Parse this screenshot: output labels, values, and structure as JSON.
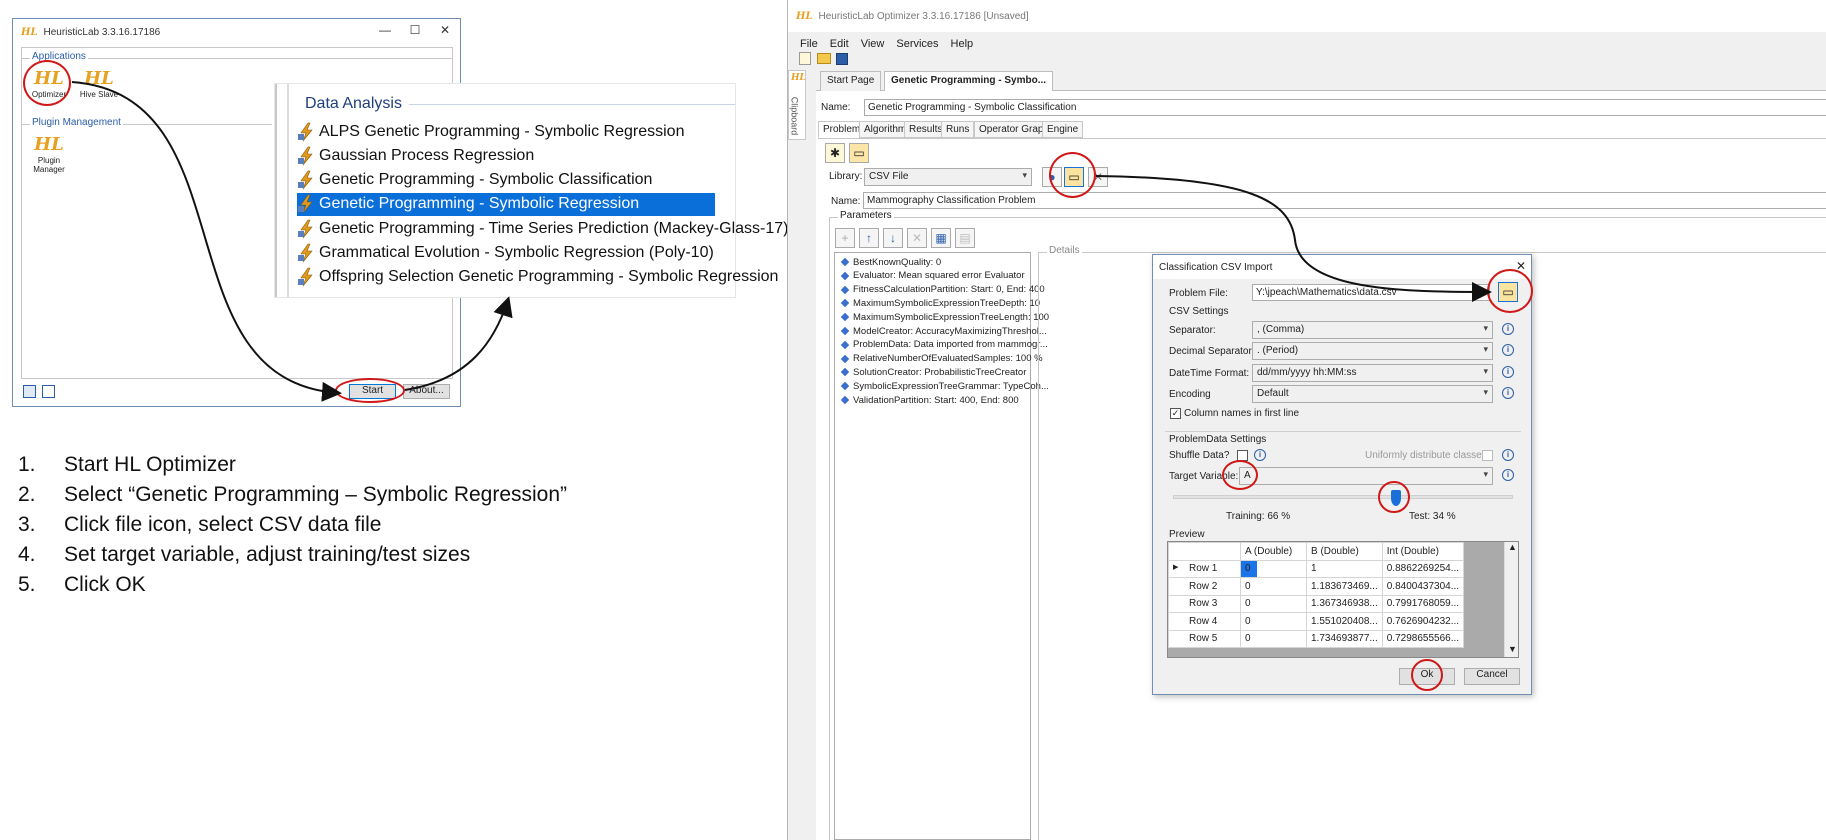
{
  "launcher": {
    "title": "HeuristicLab 3.3.16.17186",
    "title_logo": "HL",
    "minimize": "—",
    "maximize": "☐",
    "close": "✕",
    "applications_group": "Applications",
    "plugin_group": "Plugin Management",
    "apps": [
      {
        "logo": "HL",
        "label": "Optimizer"
      },
      {
        "logo": "HL",
        "label": "Hive Slave"
      }
    ],
    "plugin_app": {
      "logo": "HL",
      "label": "Plugin Manager"
    },
    "start_button": "Start",
    "about_button": "About..."
  },
  "data_analysis": {
    "heading": "Data Analysis",
    "items": [
      "ALPS Genetic Programming - Symbolic Regression",
      "Gaussian Process Regression",
      "Genetic Programming - Symbolic Classification",
      "Genetic Programming - Symbolic Regression",
      "Genetic Programming - Time Series Prediction (Mackey-Glass-17)",
      "Grammatical Evolution - Symbolic Regression (Poly-10)",
      "Offspring Selection Genetic Programming - Symbolic Regression"
    ],
    "selected_index": 3
  },
  "steps": [
    {
      "num": "1.",
      "text": "Start HL Optimizer"
    },
    {
      "num": "2.",
      "text": "Select “Genetic Programming – Symbolic Regression”"
    },
    {
      "num": "3.",
      "text": "Click file icon, select CSV data file"
    },
    {
      "num": "4.",
      "text": "Set target variable, adjust training/test sizes"
    },
    {
      "num": "5.",
      "text": "Click OK"
    }
  ],
  "optimizer": {
    "title_logo": "HL",
    "title": "HeuristicLab Optimizer 3.3.16.17186 [Unsaved]",
    "menu": [
      "File",
      "Edit",
      "View",
      "Services",
      "Help"
    ],
    "side_tab": "Clipboard",
    "tabs": [
      "Start Page",
      "Genetic Programming - Symbo..."
    ],
    "name_label": "Name:",
    "name_value": "Genetic Programming - Symbolic Classification",
    "subtabs": [
      "Problem",
      "Algorithm",
      "Results",
      "Runs",
      "Operator Graph",
      "Engine"
    ],
    "library_label": "Library:",
    "library_value": "CSV File",
    "problem_name_label": "Name:",
    "problem_name_value": "Mammography Classification Problem",
    "parameters_label": "Parameters",
    "details_label": "Details",
    "parameters": [
      "BestKnownQuality: 0",
      "Evaluator: Mean squared error Evaluator",
      "FitnessCalculationPartition: Start: 0, End: 400",
      "MaximumSymbolicExpressionTreeDepth: 10",
      "MaximumSymbolicExpressionTreeLength: 100",
      "ModelCreator: AccuracyMaximizingThreshol...",
      "ProblemData: Data imported from mammogr...",
      "RelativeNumberOfEvaluatedSamples: 100 %",
      "SolutionCreator: ProbabilisticTreeCreator",
      "SymbolicExpressionTreeGrammar: TypeCoh...",
      "ValidationPartition: Start: 400, End: 800"
    ]
  },
  "csv_dialog": {
    "title": "Classification CSV Import",
    "close": "✕",
    "problem_file_label": "Problem File:",
    "problem_file_value": "Y:\\jpeach\\Mathematics\\data.csv",
    "csv_settings_label": "CSV Settings",
    "separator_label": "Separator:",
    "separator_value": ", (Comma)",
    "decimal_label": "Decimal Separator:",
    "decimal_value": ". (Period)",
    "datetime_label": "DateTime Format:",
    "datetime_value": "dd/mm/yyyy hh:MM:ss",
    "encoding_label": "Encoding",
    "encoding_value": "Default",
    "column_names_label": "Column names in first line",
    "column_names_checked": true,
    "problemdata_label": "ProblemData Settings",
    "shuffle_label": "Shuffle Data?",
    "uniform_label": "Uniformly distribute classes",
    "target_label": "Target Variable:",
    "target_value": "A",
    "training_label": "Training: 66 %",
    "test_label": "Test: 34 %",
    "training_fraction": 0.66,
    "preview_label": "Preview",
    "preview_columns": [
      "A (Double)",
      "B (Double)",
      "Int (Double)"
    ],
    "preview_rows": [
      {
        "name": "Row 1",
        "cells": [
          "0",
          "1",
          "0.8862269254..."
        ]
      },
      {
        "name": "Row 2",
        "cells": [
          "0",
          "1.183673469...",
          "0.8400437304..."
        ]
      },
      {
        "name": "Row 3",
        "cells": [
          "0",
          "1.367346938...",
          "0.7991768059..."
        ]
      },
      {
        "name": "Row 4",
        "cells": [
          "0",
          "1.551020408...",
          "0.7626904232..."
        ]
      },
      {
        "name": "Row 5",
        "cells": [
          "0",
          "1.734693877...",
          "0.7298655566..."
        ]
      }
    ],
    "ok_button": "Ok",
    "cancel_button": "Cancel"
  }
}
